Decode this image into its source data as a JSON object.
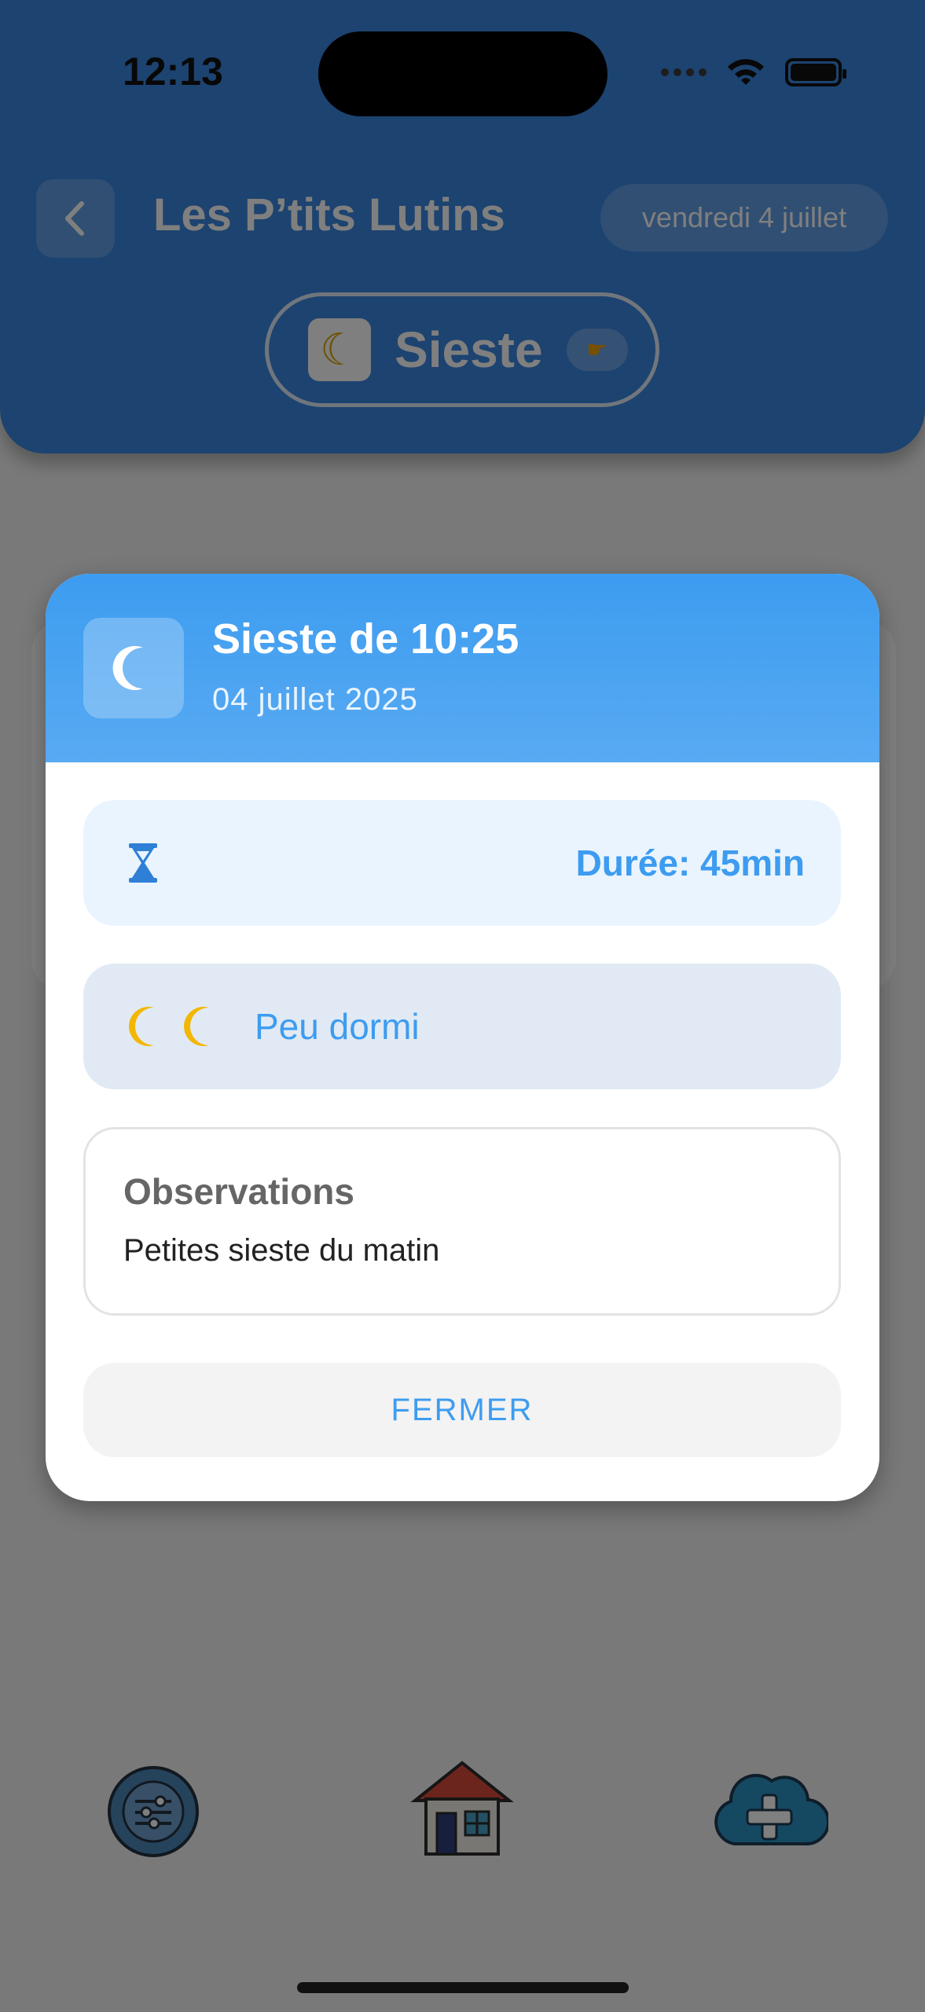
{
  "status": {
    "time": "12:13"
  },
  "header": {
    "title": "Les P’tits Lutins",
    "date": "vendredi 4 juillet",
    "mode_label": "Sieste"
  },
  "modal": {
    "title": "Sieste de 10:25",
    "date": "04 juillet 2025",
    "duration": "Durée: 45min",
    "quality": "Peu dormi",
    "observations_title": "Observations",
    "observations_text": "Petites sieste du matin",
    "close_label": "FERMER"
  },
  "colors": {
    "primary": "#3d9cf0",
    "header_bg": "#3a86e0",
    "moon_yellow": "#f2b705"
  },
  "icons": {
    "back": "chevron-left-icon",
    "mode": "moon-stars-icon",
    "modal": "moon-icon",
    "duration": "hourglass-icon",
    "quality": "moon-icon",
    "nav": [
      "settings-gear-icon",
      "home-house-icon",
      "add-cloud-icon"
    ]
  }
}
